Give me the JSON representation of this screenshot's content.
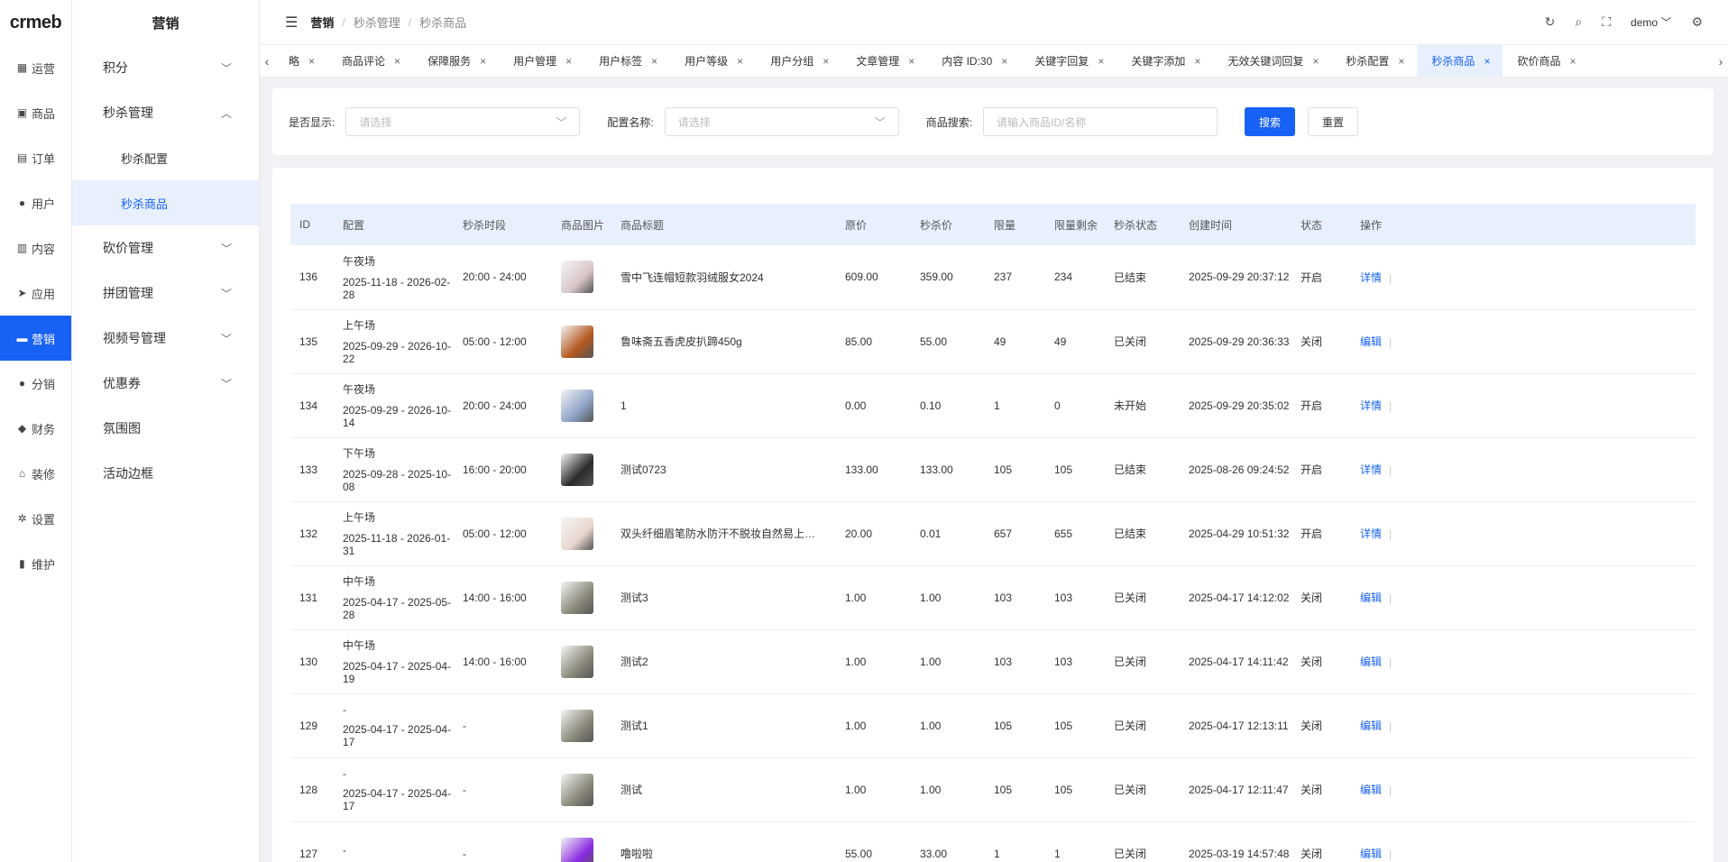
{
  "logo": "crmeb",
  "rail": [
    {
      "icon": "grid-icon",
      "glyph": "▦",
      "label": "运营"
    },
    {
      "icon": "bag-icon",
      "glyph": "▣",
      "label": "商品"
    },
    {
      "icon": "order-icon",
      "glyph": "▤",
      "label": "订单"
    },
    {
      "icon": "user-icon",
      "glyph": "●",
      "label": "用户"
    },
    {
      "icon": "content-icon",
      "glyph": "▥",
      "label": "内容"
    },
    {
      "icon": "send-icon",
      "glyph": "➤",
      "label": "应用"
    },
    {
      "icon": "marketing-icon",
      "glyph": "▬",
      "label": "营销"
    },
    {
      "icon": "distribution-icon",
      "glyph": "●",
      "label": "分销"
    },
    {
      "icon": "finance-icon",
      "glyph": "◆",
      "label": "财务"
    },
    {
      "icon": "home-icon",
      "glyph": "⌂",
      "label": "装修"
    },
    {
      "icon": "gear-icon",
      "glyph": "✲",
      "label": "设置"
    },
    {
      "icon": "maintenance-icon",
      "glyph": "▮",
      "label": "维护"
    }
  ],
  "subside": {
    "title": "营销",
    "items": [
      {
        "type": "group",
        "label": "积分",
        "chev": "﹀"
      },
      {
        "type": "group",
        "label": "秒杀管理",
        "chev": "︿"
      },
      {
        "type": "child",
        "label": "秒杀配置"
      },
      {
        "type": "child",
        "label": "秒杀商品",
        "active": true
      },
      {
        "type": "group",
        "label": "砍价管理",
        "chev": "﹀"
      },
      {
        "type": "group",
        "label": "拼团管理",
        "chev": "﹀"
      },
      {
        "type": "group",
        "label": "视频号管理",
        "chev": "﹀"
      },
      {
        "type": "group",
        "label": "优惠券",
        "chev": "﹀"
      },
      {
        "type": "group",
        "label": "氛围图",
        "chev": ""
      },
      {
        "type": "group",
        "label": "活动边框",
        "chev": ""
      }
    ]
  },
  "header": {
    "breadcrumb": [
      "营销",
      "秒杀管理",
      "秒杀商品"
    ],
    "user": "demo"
  },
  "tags": [
    "略",
    "商品评论",
    "保障服务",
    "用户管理",
    "用户标签",
    "用户等级",
    "用户分组",
    "文章管理",
    "内容 ID:30",
    "关键字回复",
    "关键字添加",
    "无效关键词回复",
    "秒杀配置",
    "秒杀商品",
    "砍价商品"
  ],
  "active_tag": "秒杀商品",
  "filter": {
    "show_label": "是否显示:",
    "show_placeholder": "请选择",
    "config_label": "配置名称:",
    "config_placeholder": "请选择",
    "search_label": "商品搜索:",
    "search_placeholder": "请输入商品ID/名称",
    "search_btn": "搜索",
    "reset_btn": "重置"
  },
  "table": {
    "columns": [
      "ID",
      "配置",
      "秒杀时段",
      "商品图片",
      "商品标题",
      "原价",
      "秒杀价",
      "限量",
      "限量剩余",
      "秒杀状态",
      "创建时间",
      "状态",
      "操作"
    ],
    "rows": [
      {
        "id": "136",
        "cfg_name": "午夜场",
        "cfg_range": "2025-11-18 - 2026-02-28",
        "period": "20:00 - 24:00",
        "img": "#d9c6c8",
        "title": "雪中飞连帽短款羽绒服女2024",
        "price": "609.00",
        "seckill": "359.00",
        "quota": "237",
        "left": "234",
        "sk_status": "已结束",
        "created": "2025-09-29 20:37:12",
        "status": "开启",
        "op": "详情"
      },
      {
        "id": "135",
        "cfg_name": "上午场",
        "cfg_range": "2025-09-29 - 2026-10-22",
        "period": "05:00 - 12:00",
        "img": "#b5581f",
        "title": "鲁味斋五香虎皮扒蹄450g",
        "price": "85.00",
        "seckill": "55.00",
        "quota": "49",
        "left": "49",
        "sk_status": "已关闭",
        "created": "2025-09-29 20:36:33",
        "status": "关闭",
        "op": "编辑"
      },
      {
        "id": "134",
        "cfg_name": "午夜场",
        "cfg_range": "2025-09-29 - 2026-10-14",
        "period": "20:00 - 24:00",
        "img": "#8ea3c6",
        "title": "1",
        "price": "0.00",
        "seckill": "0.10",
        "quota": "1",
        "left": "0",
        "sk_status": "未开始",
        "created": "2025-09-29 20:35:02",
        "status": "开启",
        "op": "详情"
      },
      {
        "id": "133",
        "cfg_name": "下午场",
        "cfg_range": "2025-09-28 - 2025-10-08",
        "period": "16:00 - 20:00",
        "img": "#2b2b2b",
        "title": "测试0723",
        "price": "133.00",
        "seckill": "133.00",
        "quota": "105",
        "left": "105",
        "sk_status": "已结束",
        "created": "2025-08-26 09:24:52",
        "status": "开启",
        "op": "详情"
      },
      {
        "id": "132",
        "cfg_name": "上午场",
        "cfg_range": "2025-11-18 - 2026-01-31",
        "period": "05:00 - 12:00",
        "img": "#e8d6cf",
        "title": "双头纤细眉笔防水防汗不脱妆自然易上色持久不晕染",
        "price": "20.00",
        "seckill": "0.01",
        "quota": "657",
        "left": "655",
        "sk_status": "已结束",
        "created": "2025-04-29 10:51:32",
        "status": "开启",
        "op": "详情"
      },
      {
        "id": "131",
        "cfg_name": "中午场",
        "cfg_range": "2025-04-17 - 2025-05-28",
        "period": "14:00 - 16:00",
        "img": "#8b8a7a",
        "title": "测试3",
        "price": "1.00",
        "seckill": "1.00",
        "quota": "103",
        "left": "103",
        "sk_status": "已关闭",
        "created": "2025-04-17 14:12:02",
        "status": "关闭",
        "op": "编辑"
      },
      {
        "id": "130",
        "cfg_name": "中午场",
        "cfg_range": "2025-04-17 - 2025-04-19",
        "period": "14:00 - 16:00",
        "img": "#8b8a7a",
        "title": "测试2",
        "price": "1.00",
        "seckill": "1.00",
        "quota": "103",
        "left": "103",
        "sk_status": "已关闭",
        "created": "2025-04-17 14:11:42",
        "status": "关闭",
        "op": "编辑"
      },
      {
        "id": "129",
        "cfg_name": "-",
        "cfg_range": "2025-04-17 - 2025-04-17",
        "period": "-",
        "img": "#8b8a7a",
        "title": "测试1",
        "price": "1.00",
        "seckill": "1.00",
        "quota": "105",
        "left": "105",
        "sk_status": "已关闭",
        "created": "2025-04-17 12:13:11",
        "status": "关闭",
        "op": "编辑"
      },
      {
        "id": "128",
        "cfg_name": "-",
        "cfg_range": "2025-04-17 - 2025-04-17",
        "period": "-",
        "img": "#8b8a7a",
        "title": "测试",
        "price": "1.00",
        "seckill": "1.00",
        "quota": "105",
        "left": "105",
        "sk_status": "已关闭",
        "created": "2025-04-17 12:11:47",
        "status": "关闭",
        "op": "编辑"
      },
      {
        "id": "127",
        "cfg_name": "-",
        "cfg_range": "",
        "period": "-",
        "img": "#8a2be2",
        "title": "噜啦啦",
        "price": "55.00",
        "seckill": "33.00",
        "quota": "1",
        "left": "1",
        "sk_status": "已关闭",
        "created": "2025-03-19 14:57:48",
        "status": "关闭",
        "op": "编辑"
      }
    ]
  }
}
